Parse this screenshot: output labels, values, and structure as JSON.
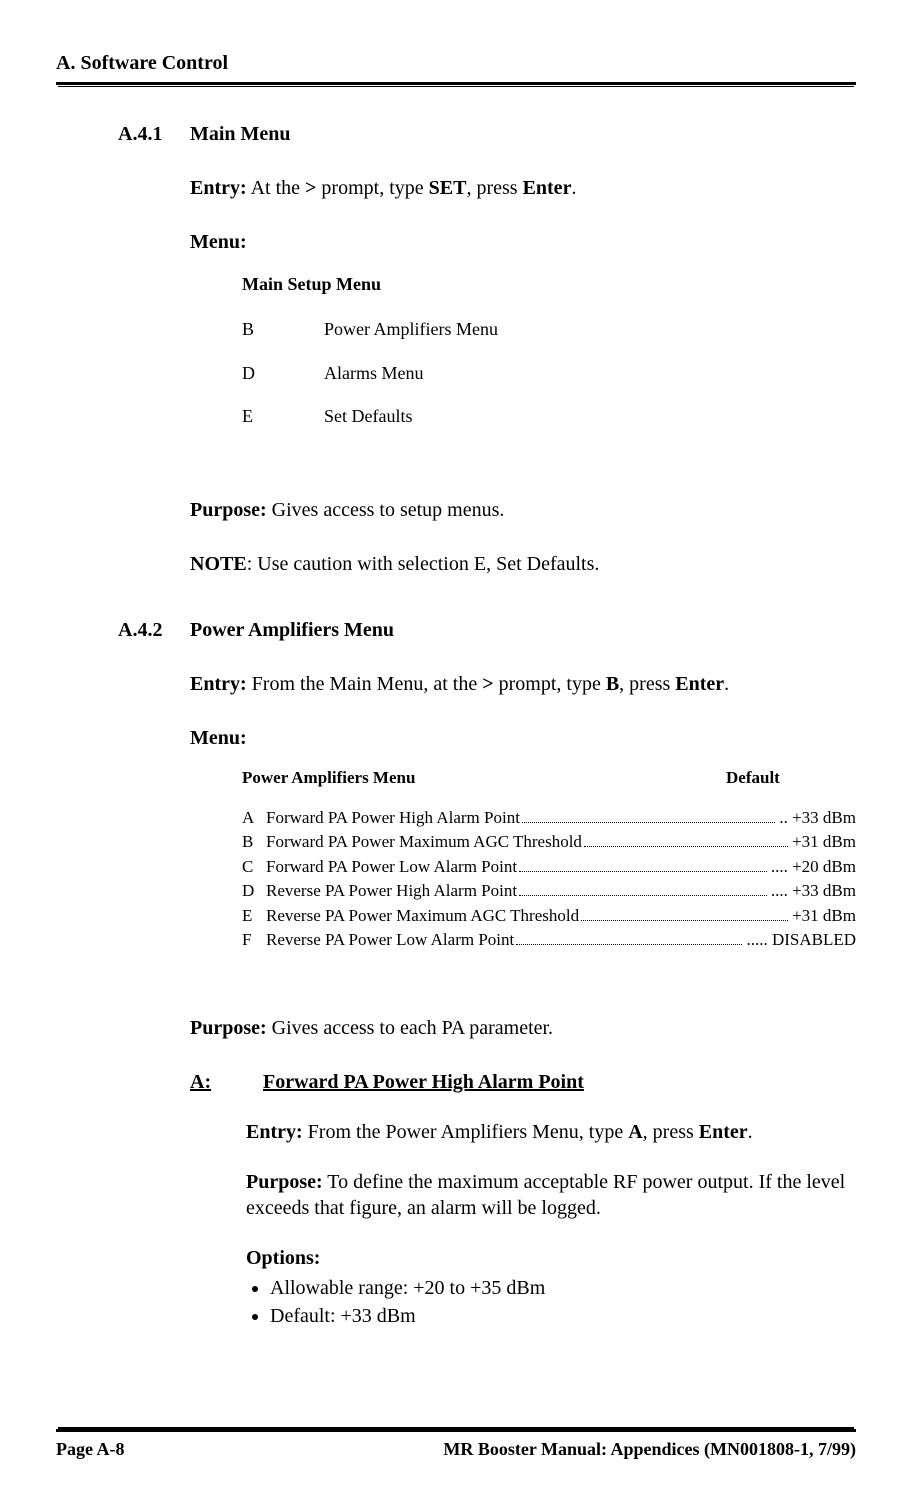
{
  "header": "A. Software Control",
  "s1": {
    "num": "A.4.1",
    "title": "Main Menu",
    "entry_label": "Entry:",
    "entry_text_1": "  At the ",
    "entry_gt": ">",
    "entry_text_2": " prompt, type ",
    "entry_cmd": "SET",
    "entry_text_3": ", press ",
    "entry_enter": "Enter",
    "entry_text_4": ".",
    "menu_label": "Menu:",
    "menu_title": "Main Setup Menu",
    "items": [
      {
        "key": "B",
        "val": "Power Amplifiers Menu"
      },
      {
        "key": "D",
        "val": "Alarms Menu"
      },
      {
        "key": "E",
        "val": "Set Defaults"
      }
    ],
    "purpose_label": "Purpose:",
    "purpose_text": "  Gives access to setup menus.",
    "note_label": "NOTE",
    "note_text": ":  Use caution with selection E, Set Defaults."
  },
  "s2": {
    "num": "A.4.2",
    "title": "Power Amplifiers Menu",
    "entry_label": "Entry:",
    "entry_text_1": "  From the Main Menu, at the ",
    "entry_gt": ">",
    "entry_text_2": " prompt, type ",
    "entry_cmd": "B",
    "entry_text_3": ", press ",
    "entry_enter": "Enter",
    "entry_text_4": ".",
    "menu_label": "Menu:",
    "pa_title": "Power Amplifiers Menu",
    "pa_default_header": "Default",
    "pa_items": [
      {
        "key": "A",
        "label": "Forward PA Power High Alarm Point ",
        "default": ".. +33 dBm"
      },
      {
        "key": "B",
        "label": "Forward PA Power Maximum AGC Threshold",
        "default": " +31 dBm"
      },
      {
        "key": "C",
        "label": "Forward PA Power Low Alarm Point",
        "default": ".... +20 dBm"
      },
      {
        "key": "D",
        "label": "Reverse PA Power High Alarm Point",
        "default": ".... +33 dBm"
      },
      {
        "key": "E",
        "label": "Reverse PA Power Maximum AGC Threshold",
        "default": " +31 dBm"
      },
      {
        "key": "F",
        "label": "Reverse PA Power Low Alarm Point",
        "default": "..... DISABLED"
      }
    ],
    "purpose_label": "Purpose:",
    "purpose_text": "  Gives access to each PA parameter.",
    "sub_key_label": "A:",
    "sub_title": "Forward PA Power High Alarm Point",
    "a_entry_label": "Entry:",
    "a_entry_text_1": " From the Power Amplifiers Menu, type ",
    "a_entry_cmd": "A",
    "a_entry_text_2": ", press ",
    "a_entry_enter": "Enter",
    "a_entry_text_3": ".",
    "a_purpose_label": "Purpose:",
    "a_purpose_text": " To define the maximum acceptable RF power output. If the level exceeds that figure, an alarm will be logged.",
    "a_options_label": "Options:",
    "a_options": [
      "Allowable range: +20 to +35 dBm",
      "Default: +33 dBm"
    ]
  },
  "footer": {
    "left": "Page A-8",
    "right": "MR Booster Manual: Appendices (MN001808-1, 7/99)"
  }
}
